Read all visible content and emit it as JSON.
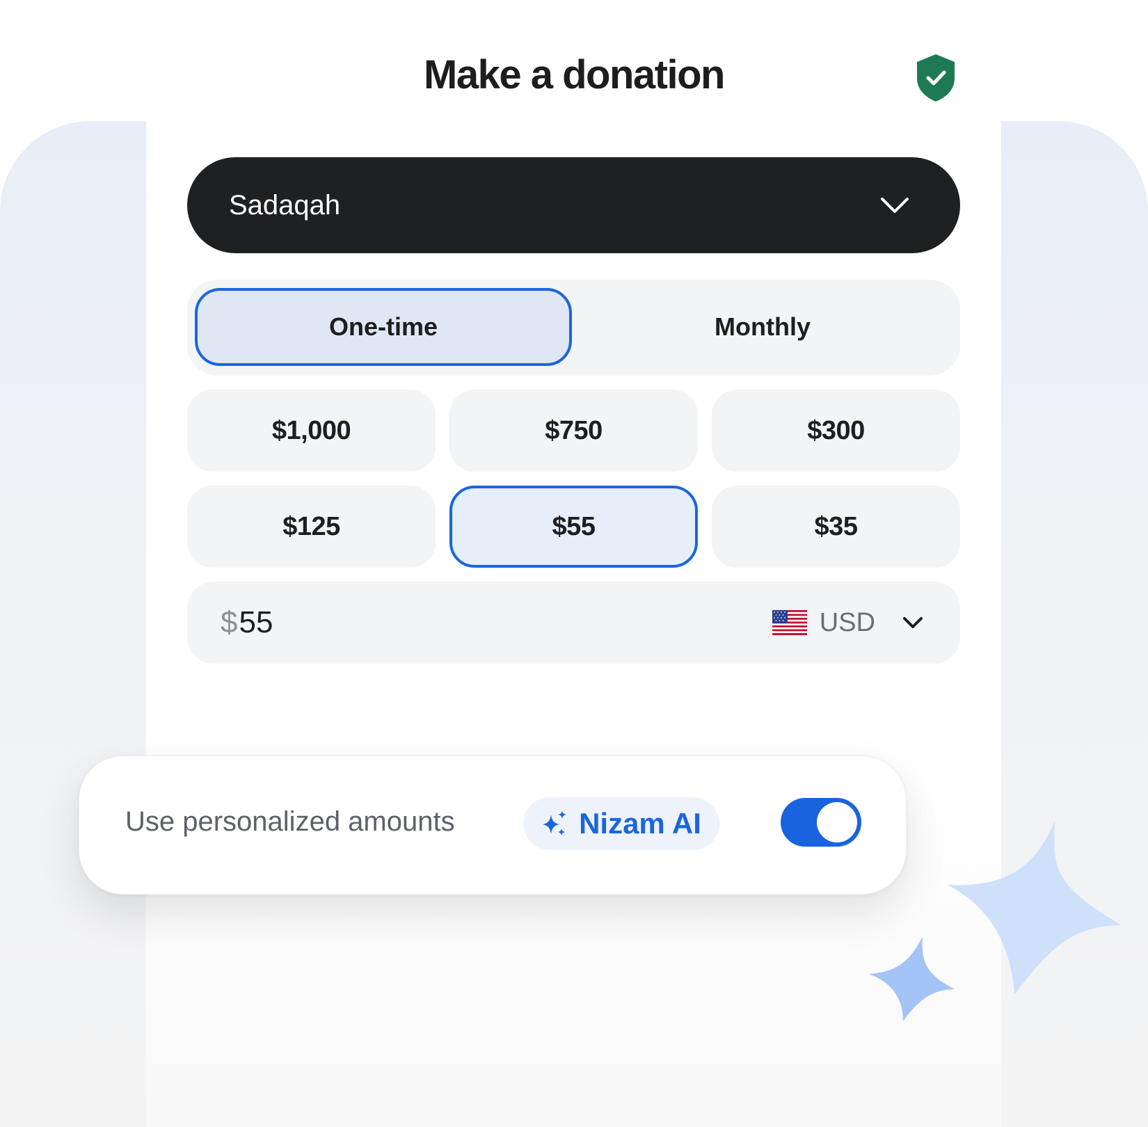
{
  "header": {
    "title": "Make a donation",
    "trust_icon": "shield-check-icon",
    "trust_color": "#1d7a52"
  },
  "fund_select": {
    "value": "Sadaqah",
    "icon": "chevron-down-icon"
  },
  "frequency": {
    "options": [
      "One-time",
      "Monthly"
    ],
    "selected": "One-time"
  },
  "amounts": {
    "options": [
      "$1,000",
      "$750",
      "$300",
      "$125",
      "$55",
      "$35"
    ],
    "selected": "$55"
  },
  "custom_amount": {
    "symbol": "$",
    "value": "55",
    "currency_code": "USD",
    "flag_icon": "us-flag-icon"
  },
  "personalize": {
    "label": "Use personalized amounts",
    "badge_name": "Nizam AI",
    "badge_icon": "sparkle-icon",
    "toggle_on": true
  },
  "colors": {
    "accent": "#1b66de",
    "dark": "#1f2022",
    "surface": "#f3f4f6",
    "sparkle": "#a9c6f5"
  }
}
